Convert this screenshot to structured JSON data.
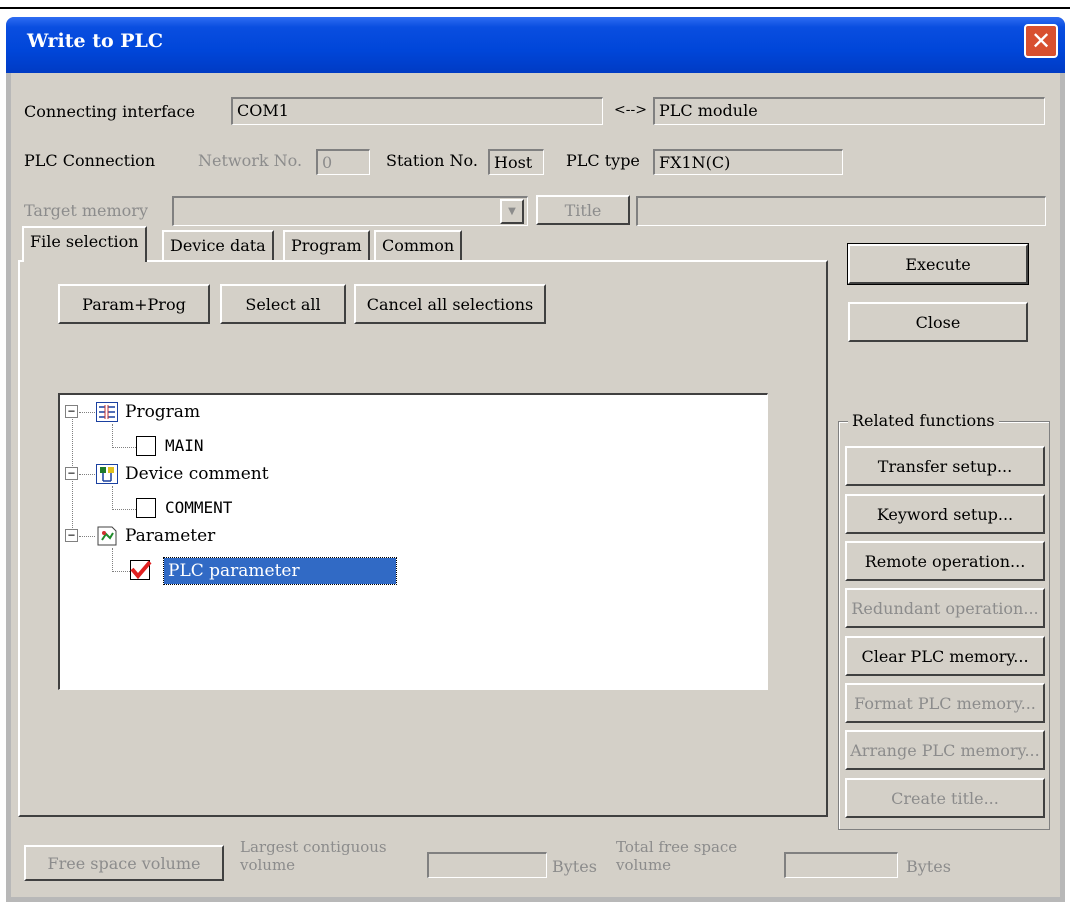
{
  "window": {
    "title": "Write to PLC"
  },
  "connection": {
    "interface_label": "Connecting interface",
    "interface_value": "COM1",
    "arrow": "<-->",
    "target_value": "PLC module",
    "plc_connection_label": "PLC Connection",
    "network_label": "Network No.",
    "network_value": "0",
    "station_label": "Station No.",
    "station_value": "Host",
    "plc_type_label": "PLC type",
    "plc_type_value": "FX1N(C)",
    "target_memory_label": "Target memory",
    "target_memory_value": "",
    "title_button": "Title",
    "title_value": ""
  },
  "tabs": [
    {
      "label": "File selection",
      "active": true
    },
    {
      "label": "Device data",
      "active": false
    },
    {
      "label": "Program",
      "active": false
    },
    {
      "label": "Common",
      "active": false
    }
  ],
  "selection_buttons": {
    "param_prog": "Param+Prog",
    "select_all": "Select all",
    "cancel_all": "Cancel all selections"
  },
  "tree": {
    "program_label": "Program",
    "main_label": "MAIN",
    "main_checked": false,
    "device_comment_label": "Device comment",
    "comment_label": "COMMENT",
    "comment_checked": false,
    "parameter_label": "Parameter",
    "plc_parameter_label": "PLC parameter",
    "plc_parameter_checked": true
  },
  "actions": {
    "execute": "Execute",
    "close": "Close"
  },
  "related": {
    "group_label": "Related functions",
    "transfer_setup": "Transfer setup...",
    "keyword_setup": "Keyword setup...",
    "remote_operation": "Remote operation...",
    "redundant_operation": "Redundant operation...",
    "clear_plc_memory": "Clear PLC memory...",
    "format_plc_memory": "Format PLC memory...",
    "arrange_plc_memory": "Arrange PLC memory...",
    "create_title": "Create title..."
  },
  "footer": {
    "free_space_button": "Free space volume",
    "largest_label_1": "Largest contiguous",
    "largest_label_2": "volume",
    "largest_value": "",
    "bytes_1": "Bytes",
    "total_label_1": "Total free space",
    "total_label_2": "volume",
    "total_value": "",
    "bytes_2": "Bytes"
  },
  "colors": {
    "titlebar": "#0046d9",
    "dialog_bg": "#d4d0c8",
    "selection": "#316ac5",
    "check": "#e02020",
    "close_button": "#d8502f"
  }
}
